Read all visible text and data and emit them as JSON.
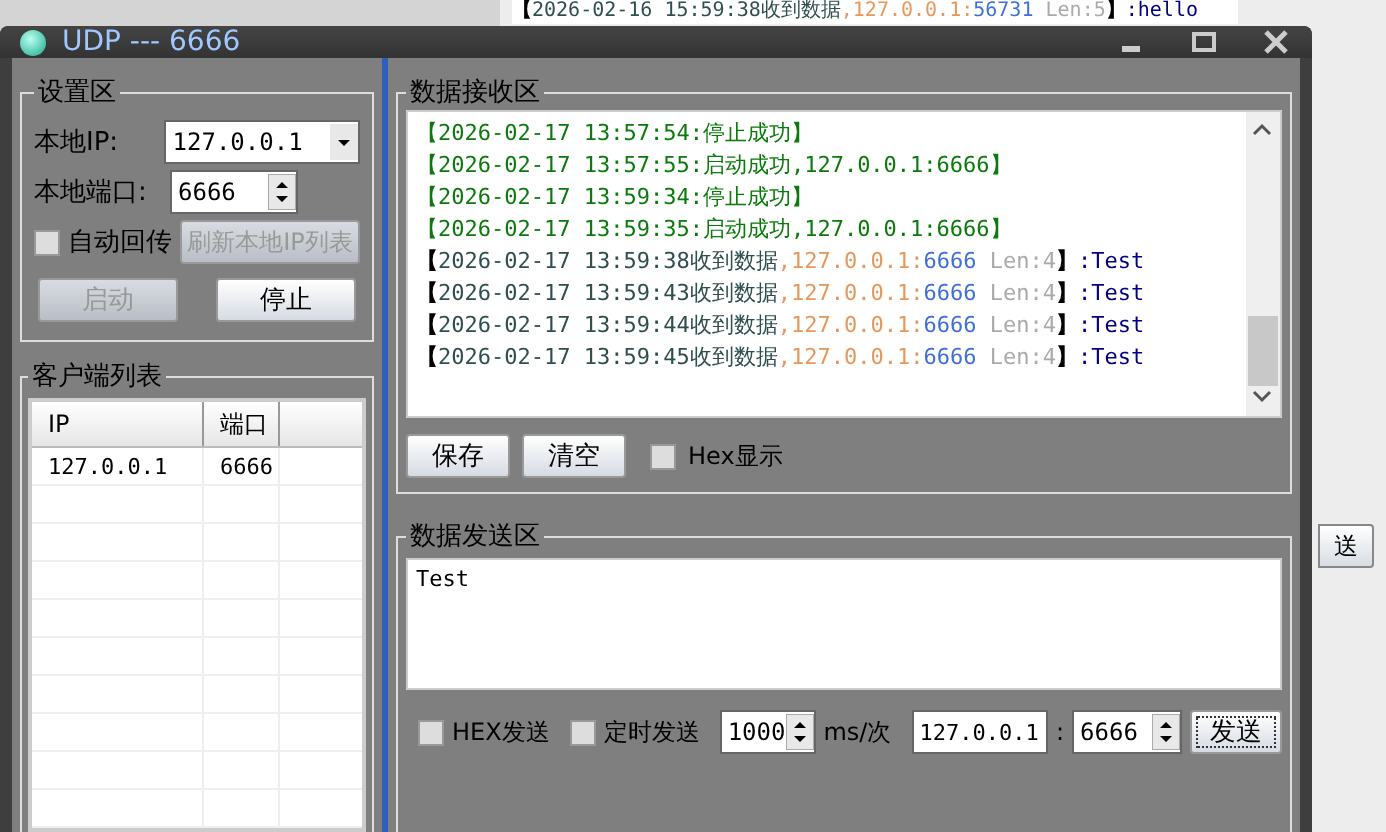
{
  "background_window": {
    "log_line": {
      "open": "【",
      "time": "2026-02-16 15:59:38收到数据",
      "ip": ",127.0.0.1:",
      "port": "56731",
      "len": " Len:5",
      "close": "】",
      "data": ":hello"
    },
    "button": "送"
  },
  "window": {
    "title": "UDP --- 6666"
  },
  "settings": {
    "title": "设置区",
    "local_ip_label": "本地IP:",
    "local_ip": "127.0.0.1",
    "local_port_label": "本地端口:",
    "local_port": "6666",
    "auto_reply": {
      "label": "自动回传",
      "checked": false
    },
    "refresh_button": {
      "label": "刷新本地IP列表",
      "disabled": true
    },
    "start_button": {
      "label": "启动",
      "disabled": true
    },
    "stop_button": {
      "label": "停止",
      "disabled": false
    }
  },
  "clients": {
    "title": "客户端列表",
    "columns": [
      "IP",
      "端口"
    ],
    "rows": [
      [
        "127.0.0.1",
        "6666"
      ]
    ]
  },
  "receive": {
    "title": "数据接收区",
    "lines": [
      {
        "kind": "status",
        "text": "【2026-02-17 13:57:54:停止成功】"
      },
      {
        "kind": "status",
        "text": "【2026-02-17 13:57:55:启动成功,127.0.0.1:6666】"
      },
      {
        "kind": "status",
        "text": "【2026-02-17 13:59:34:停止成功】"
      },
      {
        "kind": "status",
        "text": "【2026-02-17 13:59:35:启动成功,127.0.0.1:6666】"
      },
      {
        "kind": "received",
        "open": "【",
        "time": "2026-02-17 13:59:38收到数据",
        "ip": ",127.0.0.1:",
        "port": "6666",
        "len": " Len:4",
        "close": "】",
        "data": ":Test"
      },
      {
        "kind": "received",
        "open": "【",
        "time": "2026-02-17 13:59:43收到数据",
        "ip": ",127.0.0.1:",
        "port": "6666",
        "len": " Len:4",
        "close": "】",
        "data": ":Test"
      },
      {
        "kind": "received",
        "open": "【",
        "time": "2026-02-17 13:59:44收到数据",
        "ip": ",127.0.0.1:",
        "port": "6666",
        "len": " Len:4",
        "close": "】",
        "data": ":Test"
      },
      {
        "kind": "received",
        "open": "【",
        "time": "2026-02-17 13:59:45收到数据",
        "ip": ",127.0.0.1:",
        "port": "6666",
        "len": " Len:4",
        "close": "】",
        "data": ":Test"
      }
    ],
    "save_button": "保存",
    "clear_button": "清空",
    "hex_display": {
      "label": "Hex显示",
      "checked": false
    }
  },
  "send": {
    "title": "数据发送区",
    "text": "Test",
    "hex_send": {
      "label": "HEX发送",
      "checked": false
    },
    "timed_send": {
      "label": "定时发送",
      "checked": false
    },
    "interval": "1000",
    "interval_unit": "ms/次",
    "target_ip": "127.0.0.1",
    "separator": ":",
    "target_port": "6666",
    "send_button": "发送"
  }
}
